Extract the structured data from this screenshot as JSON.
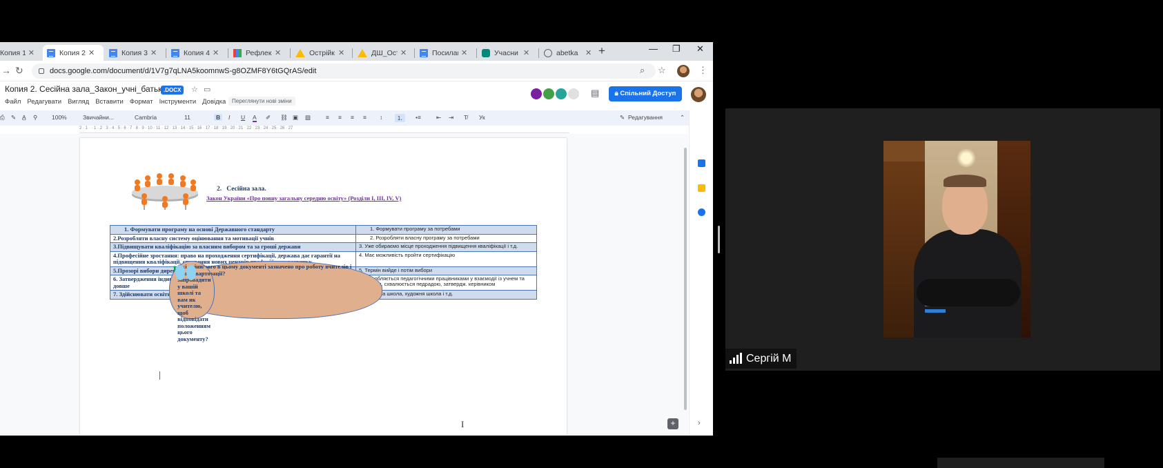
{
  "browser": {
    "tabs": [
      {
        "label": "Копия 1",
        "icon": "docs-icon"
      },
      {
        "label": "Копия 2",
        "icon": "docs-icon",
        "active": true
      },
      {
        "label": "Копия 3",
        "icon": "docs-icon"
      },
      {
        "label": "Копия 4",
        "icon": "docs-icon"
      },
      {
        "label": "Рефлекс",
        "icon": "chart-icon"
      },
      {
        "label": "Острійк",
        "icon": "drive-icon"
      },
      {
        "label": "ДШ_Остр",
        "icon": "drive-icon"
      },
      {
        "label": "Посилан",
        "icon": "docs-icon"
      },
      {
        "label": "Учасни",
        "icon": "meet-icon"
      },
      {
        "label": "abetka",
        "icon": "globe-icon"
      }
    ],
    "close_glyph": "✕",
    "new_tab_glyph": "+",
    "url": "docs.google.com/document/d/1V7g7qLNA5koomnwS-g8OZMF8Y6tGQrAS/edit"
  },
  "docs": {
    "title": "Копия 2. Сесійна зала_Закон_учні_батьки",
    "badge": ".DOCX",
    "menu": [
      "Файл",
      "Редагувати",
      "Вигляд",
      "Вставити",
      "Формат",
      "Інструменти",
      "Довідка"
    ],
    "last_edit": "Переглянути нові зміни",
    "share_label": "Спільний Доступ",
    "toolbar": {
      "zoom": "100%",
      "style": "Звичайни...",
      "font": "Cambria",
      "size": "11",
      "bold": "B",
      "italic": "I",
      "underline": "U",
      "text_color": "A",
      "mode": "Редагування"
    },
    "ruler": "2 · 1 · · 1 · 2 · 3 · 4 · 5 · 6 · 7 · 8 · 9 · 10 · 11 · 12 · 13 · 14 · 15 · 16 · 17 · 18 · 19 · 20 · 21 · 22 · 23 · 24 · 25 · 26 · 27"
  },
  "document": {
    "heading_number": "2.",
    "heading_title": "Сесійна зала.",
    "law_link": "Закон України «Про повну загальну середню освіту» (Розділи І, ІІІ, ІV, V)",
    "col1_header": "Що нового в цьому документі зазначено про роботу вчителів і адміністрації?",
    "col2_header": "Які зміни/кроки варто запровадити у вашій школі та вам як учителю, щоб відповідати положенням цього документу?",
    "rows": [
      {
        "left": "1.    Формувати програму на основі Державного стандарту",
        "right": "1.    Формувати програму за потребами",
        "shade": true
      },
      {
        "left": "2.Розробляти власну систему оцінювання та мотивації учнів",
        "right": "2.    Розробляти  власну програму за потребами",
        "shade": false
      },
      {
        "left": "3.Підвищувати кваліфікацію за власним вибором та за гроші держави",
        "right": "3. Уже обираємо місце проходження підвищення кваліфікації і т.д.",
        "shade": true
      },
      {
        "left": "4.Професійне зростання: право на проходження сертифікації, держава дає гарантії на підвищення кваліфікації. створення нових центрів професійного розвитку",
        "right": "4. Має можливість пройти сертифікацію",
        "shade": false
      },
      {
        "left": "5.Прозорі вибори директора",
        "right": "5. Термін вийде і потім вибори",
        "shade": true
      },
      {
        "left": "6. Затвердження індивідуального навчального плану, діти з ООП можуть навчатися довше",
        "right": "6.Розробляється педагогічними працівниками у взаємодії із учнем та батьками, схвалюється педрадою, затвердж. керівником",
        "shade": false
      },
      {
        "left": "7. Здійснювати освітню діяльність за різними видами освіти",
        "right": "7. Музична школа, художня школа і т.д.",
        "shade": true
      }
    ]
  },
  "video": {
    "participant_name": "Сергій М"
  },
  "colors": {
    "accent": "#1a73e8",
    "table_border": "#4a74b8",
    "table_shade": "#cfdcee",
    "link_purple": "#7030a0"
  }
}
